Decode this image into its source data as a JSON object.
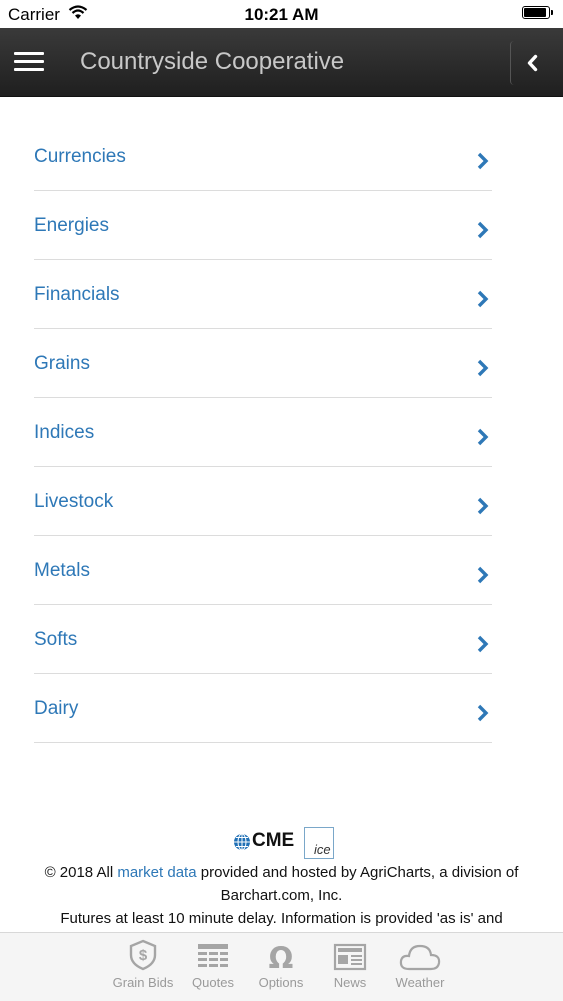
{
  "status_bar": {
    "carrier": "Carrier",
    "time": "10:21 AM"
  },
  "header": {
    "title": "Countryside Cooperative"
  },
  "menu": {
    "items": [
      {
        "label": "Currencies"
      },
      {
        "label": "Energies"
      },
      {
        "label": "Financials"
      },
      {
        "label": "Grains"
      },
      {
        "label": "Indices"
      },
      {
        "label": "Livestock"
      },
      {
        "label": "Metals"
      },
      {
        "label": "Softs"
      },
      {
        "label": "Dairy"
      }
    ]
  },
  "footer": {
    "cme_logo_text": "CME",
    "ice_logo_text": "ice",
    "copyright_prefix": "© 2018 All ",
    "market_data_link": "market data",
    "copyright_suffix": " provided and hosted by AgriCharts, a division of Barchart.com, Inc.",
    "delay_notice": "Futures at least 10 minute delay. Information is provided 'as is' and"
  },
  "tabbar": {
    "tabs": [
      {
        "label": "Grain Bids",
        "icon": "grain-bids-icon"
      },
      {
        "label": "Quotes",
        "icon": "quotes-icon"
      },
      {
        "label": "Options",
        "icon": "omega-icon"
      },
      {
        "label": "News",
        "icon": "newspaper-icon"
      },
      {
        "label": "Weather",
        "icon": "cloud-icon"
      }
    ]
  },
  "colors": {
    "link": "#2e78b7",
    "header_bg": "#2b2b2b",
    "tab_inactive": "#9a9a9a"
  }
}
